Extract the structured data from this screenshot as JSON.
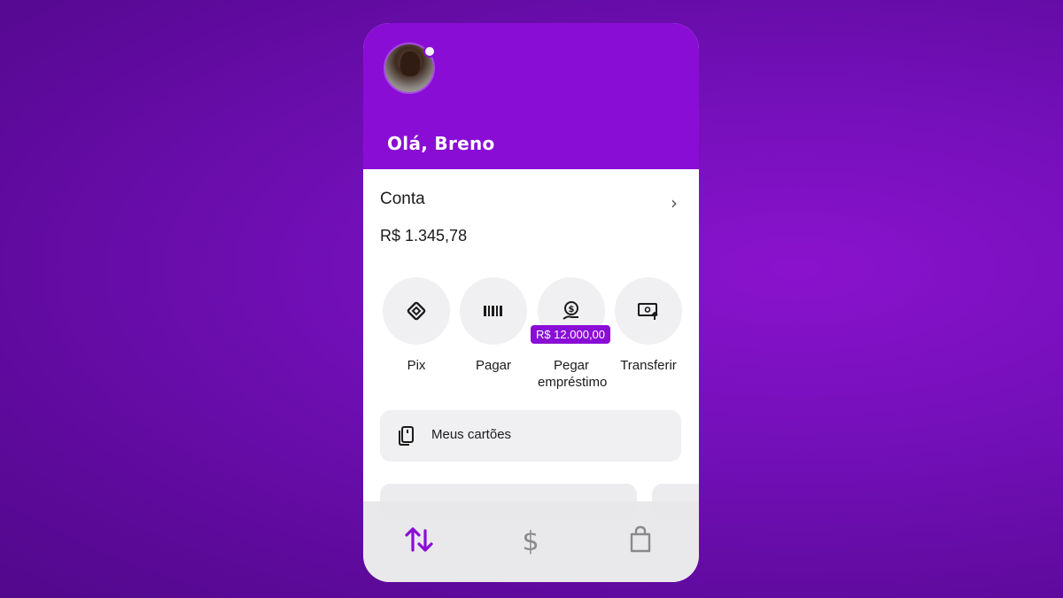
{
  "header": {
    "greeting": "Olá, Breno",
    "avatar_icon": "user-avatar",
    "notification_icon": "notification-dot"
  },
  "account": {
    "label": "Conta",
    "balance": "R$ 1.345,78",
    "chevron_icon": "chevron-right-icon"
  },
  "actions": [
    {
      "label": "Pix",
      "icon": "pix-icon"
    },
    {
      "label": "Pagar",
      "icon": "barcode-icon"
    },
    {
      "label": "Pegar empréstimo",
      "icon": "loan-icon",
      "badge": "R$ 12.000,00"
    },
    {
      "label": "Transferir",
      "icon": "transfer-icon"
    }
  ],
  "cards": {
    "label": "Meus cartões",
    "icon": "cards-icon"
  },
  "bottom_nav": [
    {
      "icon": "transactions-icon",
      "active": true
    },
    {
      "icon": "dollar-icon",
      "active": false
    },
    {
      "icon": "shopping-bag-icon",
      "active": false
    }
  ],
  "colors": {
    "brand": "#8a0dd6",
    "background": "#6a0db0",
    "surface": "#ffffff",
    "button_bg": "#f0f0f2",
    "text": "#1b1b1b",
    "inactive_icon": "#8a8a8a"
  }
}
